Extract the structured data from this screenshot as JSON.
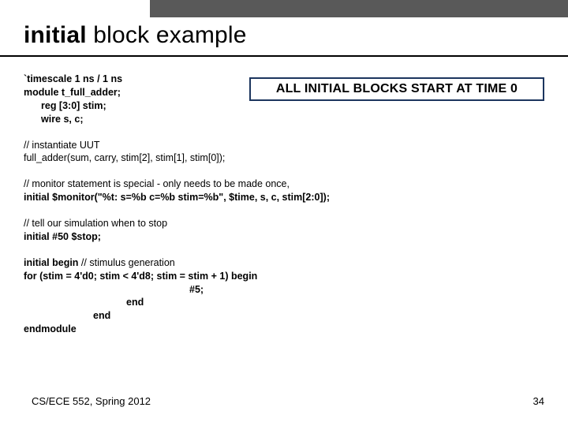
{
  "title": {
    "bold": "initial",
    "rest": " block example"
  },
  "callout": "ALL INITIAL BLOCKS START AT TIME 0",
  "block1": {
    "l1": "`timescale 1 ns / 1 ns",
    "l2": "module t_full_adder;",
    "l3": "reg [3:0] stim;",
    "l4": "wire s, c;"
  },
  "block2": {
    "l1": "// instantiate UUT",
    "l2": "full_adder(sum, carry, stim[2], stim[1], stim[0]);"
  },
  "block3": {
    "l1": "// monitor statement is special - only needs to be made once,",
    "l2a": "initial $monitor(\"%t: s=%b c=%b stim=%b\", $time, s, c, stim[2:0]);"
  },
  "block4": {
    "l1": "// tell our simulation when to stop",
    "l2": "initial #50 $stop;"
  },
  "block5": {
    "l1a": "initial begin",
    "l1b": " // stimulus generation",
    "l2": "for (stim = 4'd0; stim < 4'd8; stim = stim + 1) begin",
    "l3": "#5;",
    "l4": "end",
    "l5": "end",
    "l6": "endmodule"
  },
  "footer": {
    "left": "CS/ECE 552, Spring 2012",
    "right": "34"
  }
}
